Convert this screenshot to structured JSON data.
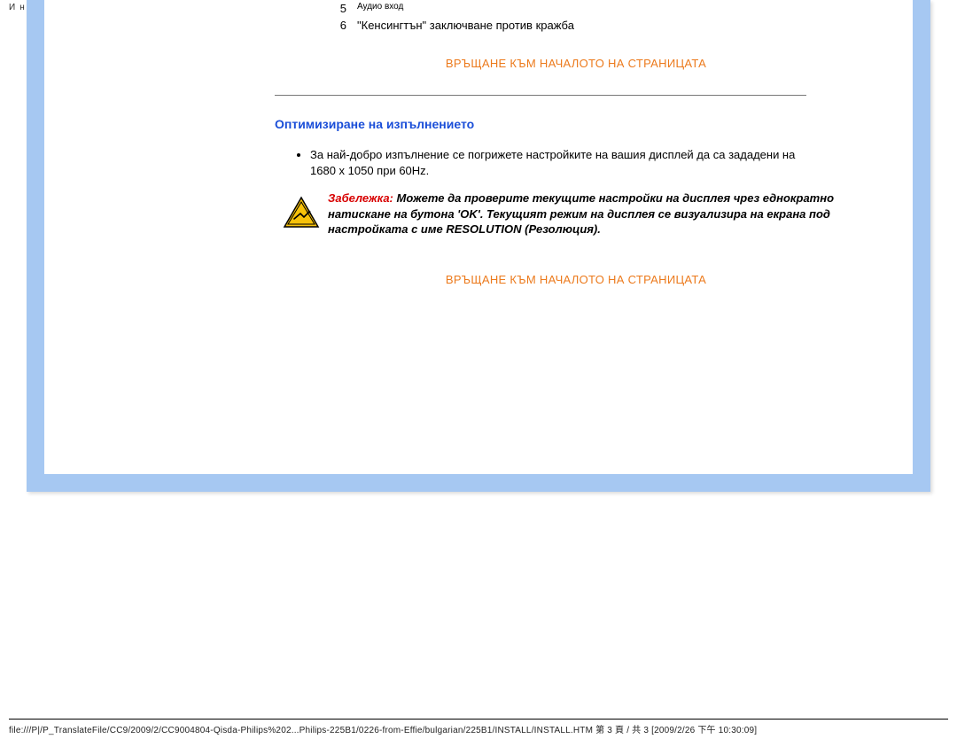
{
  "header_title": "Инсталиране на вашия течнокристален монитор",
  "list": {
    "items": [
      {
        "num": "5",
        "text": "Аудио вход",
        "small": true
      },
      {
        "num": "6",
        "text": "\"Кенсингтън\" заключване против кражба",
        "small": false
      }
    ]
  },
  "back_to_top": "ВРЪЩАНЕ КЪМ НАЧАЛОТО НА СТРАНИЦАТА",
  "section_heading": "Оптимизиране на изпълнението",
  "bullet_text": "За най-добро изпълнение се погрижете настройките на вашия дисплей да са зададени на 1680 x 1050 при 60Hz.",
  "note": {
    "label": "Забележка:",
    "body": "Можете да проверите текущите настройки на дисплея чрез еднократно натискане на бутона 'OK'. Текущият режим на дисплея се визуализира на екрана под настройката с име RESOLUTION (Резолюция)."
  },
  "footer": "file:///P|/P_TranslateFile/CC9/2009/2/CC9004804-Qisda-Philips%202...Philips-225B1/0226-from-Effie/bulgarian/225B1/INSTALL/INSTALL.HTM 第 3 頁 / 共 3  [2009/2/26 下午 10:30:09]"
}
